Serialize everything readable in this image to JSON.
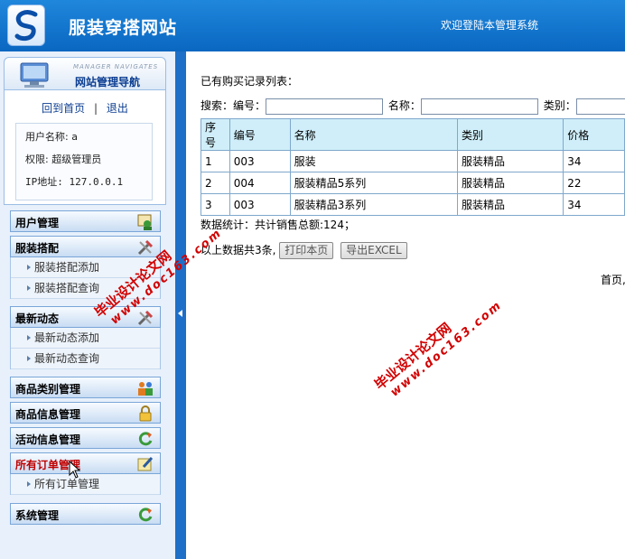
{
  "header": {
    "site_title": "服装穿搭网站",
    "welcome": "欢迎登陆本管理系统"
  },
  "sidebar": {
    "nav_subtitle": "MANAGER NAVIGATES",
    "nav_title": "网站管理导航",
    "home_link": "回到首页",
    "separator": "|",
    "logout_link": "退出",
    "user_name": "用户名称: a",
    "user_role": "权限: 超级管理员",
    "user_ip": "IP地址: 127.0.0.1",
    "menus": [
      {
        "label": "用户管理"
      },
      {
        "label": "服装搭配",
        "items": [
          "服装搭配添加",
          "服装搭配查询"
        ]
      },
      {
        "label": "最新动态",
        "items": [
          "最新动态添加",
          "最新动态查询"
        ]
      },
      {
        "label": "商品类别管理"
      },
      {
        "label": "商品信息管理"
      },
      {
        "label": "活动信息管理"
      },
      {
        "label": "所有订单管理",
        "items": [
          "所有订单管理"
        ]
      },
      {
        "label": "系统管理"
      }
    ]
  },
  "main": {
    "list_title": "已有购买记录列表：",
    "search": {
      "prefix": "搜索：",
      "code_label": "编号：",
      "name_label": "名称：",
      "category_label": "类别："
    },
    "table": {
      "headers": [
        "序号",
        "编号",
        "名称",
        "类别",
        "价格"
      ],
      "rows": [
        [
          "1",
          "003",
          "服装",
          "服装精品",
          "34"
        ],
        [
          "2",
          "004",
          "服装精品5系列",
          "服装精品",
          "22"
        ],
        [
          "3",
          "003",
          "服装精品3系列",
          "服装精品",
          "34"
        ]
      ]
    },
    "stat_text": "数据统计：共计销售总额:124；",
    "total_text": "以上数据共3条,",
    "print_button": "打印本页",
    "export_button": "导出EXCEL",
    "pager_text": "首页,"
  },
  "watermark": {
    "line1": "毕业设计论文网",
    "line2": "www.doc163.com"
  },
  "colors": {
    "header_blue": "#0a67c1",
    "splitter_blue": "#1e6fc7",
    "table_header_bg": "#cfeef9",
    "active_menu": "#c00000",
    "watermark_red": "#d20000"
  }
}
